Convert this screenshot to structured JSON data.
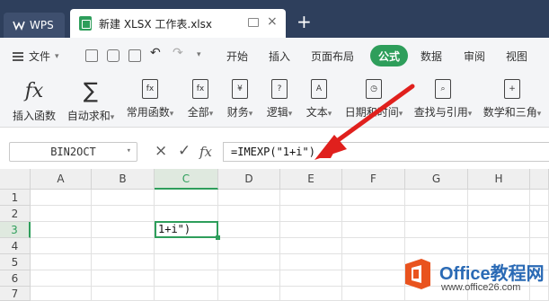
{
  "titlebar": {
    "home_tab": "WPS",
    "doc_tab": "新建 XLSX 工作表.xlsx",
    "close_glyph": "×",
    "new_tab_glyph": "+"
  },
  "menubar": {
    "file_label": "文件",
    "tabs": [
      "开始",
      "插入",
      "页面布局",
      "公式",
      "数据",
      "审阅",
      "视图"
    ],
    "active_tab": "公式"
  },
  "ribbon": {
    "buttons": [
      {
        "label": "插入函数",
        "icon": "fx-icon"
      },
      {
        "label": "自动求和",
        "icon": "sigma-icon"
      },
      {
        "label": "常用函数",
        "icon": "star-function-icon"
      },
      {
        "label": "全部",
        "icon": "fx-book-icon"
      },
      {
        "label": "财务",
        "icon": "finance-icon"
      },
      {
        "label": "逻辑",
        "icon": "logic-icon"
      },
      {
        "label": "文本",
        "icon": "text-icon"
      },
      {
        "label": "日期和时间",
        "icon": "clock-icon"
      },
      {
        "label": "查找与引用",
        "icon": "lookup-icon"
      },
      {
        "label": "数学和三角",
        "icon": "math-icon"
      }
    ],
    "glyphs": {
      "fx": "fx",
      "sigma": "∑"
    }
  },
  "formula_bar": {
    "name_box": "BIN2OCT",
    "cancel_glyph": "×",
    "confirm_glyph": "✓",
    "fx_glyph": "fx",
    "formula": "=IMEXP(\"1+i\")"
  },
  "grid": {
    "columns": [
      "A",
      "B",
      "C",
      "D",
      "E",
      "F",
      "G",
      "H"
    ],
    "rows": [
      "1",
      "2",
      "3",
      "4",
      "5",
      "6",
      "7"
    ],
    "active_column": "C",
    "active_row": "3",
    "active_cell_content": "1+i\")"
  },
  "annotation": {
    "arrow_color": "#e0201d"
  },
  "watermark": {
    "title": "Office教程网",
    "url": "www.office26.com",
    "logo_color": "#e9531e"
  },
  "colors": {
    "accent": "#2e9e5b",
    "titlebar": "#2e3f5c"
  }
}
